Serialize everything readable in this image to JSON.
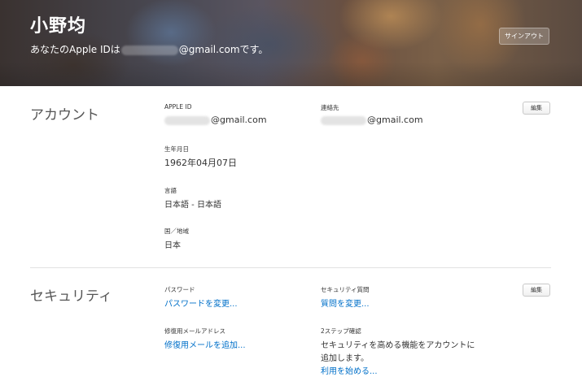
{
  "header": {
    "name": "小野均",
    "apple_id_prefix": "あなたのApple IDは",
    "apple_id_suffix": "@gmail.comです。",
    "signout_label": "サインアウト"
  },
  "account": {
    "title": "アカウント",
    "edit_label": "編集",
    "apple_id": {
      "label": "APPLE ID",
      "value_suffix": "@gmail.com"
    },
    "contact": {
      "label": "連絡先",
      "value_suffix": "@gmail.com"
    },
    "birthday": {
      "label": "生年月日",
      "value": "1962年04月07日"
    },
    "language": {
      "label": "言語",
      "value": "日本語 - 日本語"
    },
    "country": {
      "label": "国／地域",
      "value": "日本"
    }
  },
  "security": {
    "title": "セキュリティ",
    "edit_label": "編集",
    "password": {
      "label": "パスワード",
      "link": "パスワードを変更..."
    },
    "questions": {
      "label": "セキュリティ質問",
      "link": "質問を変更..."
    },
    "rescue": {
      "label": "修復用メールアドレス",
      "link": "修復用メールを追加..."
    },
    "two_step": {
      "label": "2ステップ確認",
      "text_line1": "セキュリティを高める機能をアカウントに",
      "text_line2": "追加します。",
      "link": "利用を始める..."
    }
  }
}
